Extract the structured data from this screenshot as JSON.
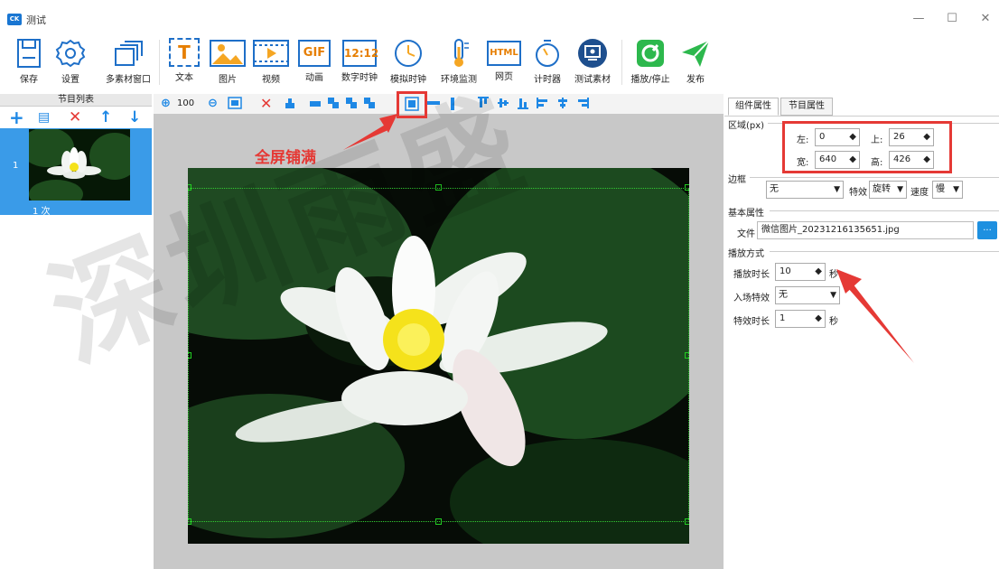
{
  "window": {
    "title": "测试",
    "logo": "CK",
    "minimize": "—",
    "maximize": "☐",
    "close": "✕"
  },
  "toolbar": {
    "save": "保存",
    "settings": "设置",
    "multi_window": "多素材窗口",
    "text": "文本",
    "text_glyph": "T",
    "image": "图片",
    "video": "视频",
    "gif": "动画",
    "gif_glyph": "GIF",
    "digital_clock": "数字时钟",
    "digital_clock_glyph": "12:12",
    "analog_clock": "模拟时钟",
    "env_monitor": "环境监测",
    "webpage": "网页",
    "webpage_glyph": "HTML",
    "timer": "计时器",
    "test_material": "测试素材",
    "play_stop": "播放/停止",
    "publish": "发布",
    "brand_green": "#2db84d",
    "brand_blue": "#1e88e5"
  },
  "program_list": {
    "header": "节目列表",
    "tools": {
      "add": "+",
      "copy": "▤",
      "delete": "✕",
      "up": "↑",
      "down": "↓"
    },
    "items": [
      {
        "index": "1",
        "count": "1 次"
      }
    ]
  },
  "canvas_toolbar": {
    "zoom_in": "⊕",
    "zoom_value": "100",
    "zoom_out": "⊖",
    "delete": "✕"
  },
  "annotation": {
    "text": "全屏铺满",
    "color": "#e53935"
  },
  "properties": {
    "tabs": [
      "组件属性",
      "节目属性"
    ],
    "region": {
      "label": "区域(px)",
      "left_label": "左:",
      "left": "0",
      "top_label": "上:",
      "top": "26",
      "width_label": "宽:",
      "width": "640",
      "height_label": "高:",
      "height": "426"
    },
    "border": {
      "label": "边框",
      "style": "无",
      "effect_label": "特效",
      "effect": "旋转",
      "speed_label": "速度",
      "speed": "慢"
    },
    "basic": {
      "label": "基本属性",
      "file_label": "文件",
      "file": "微信图片_20231216135651.jpg",
      "browse": "..."
    },
    "playback": {
      "label": "播放方式",
      "duration_label": "播放时长",
      "duration": "10",
      "duration_unit": "秒",
      "entrance_label": "入场特效",
      "entrance": "无",
      "effect_duration_label": "特效时长",
      "effect_duration": "1",
      "effect_duration_unit": "秒"
    }
  },
  "watermark": "深圳雨盛"
}
